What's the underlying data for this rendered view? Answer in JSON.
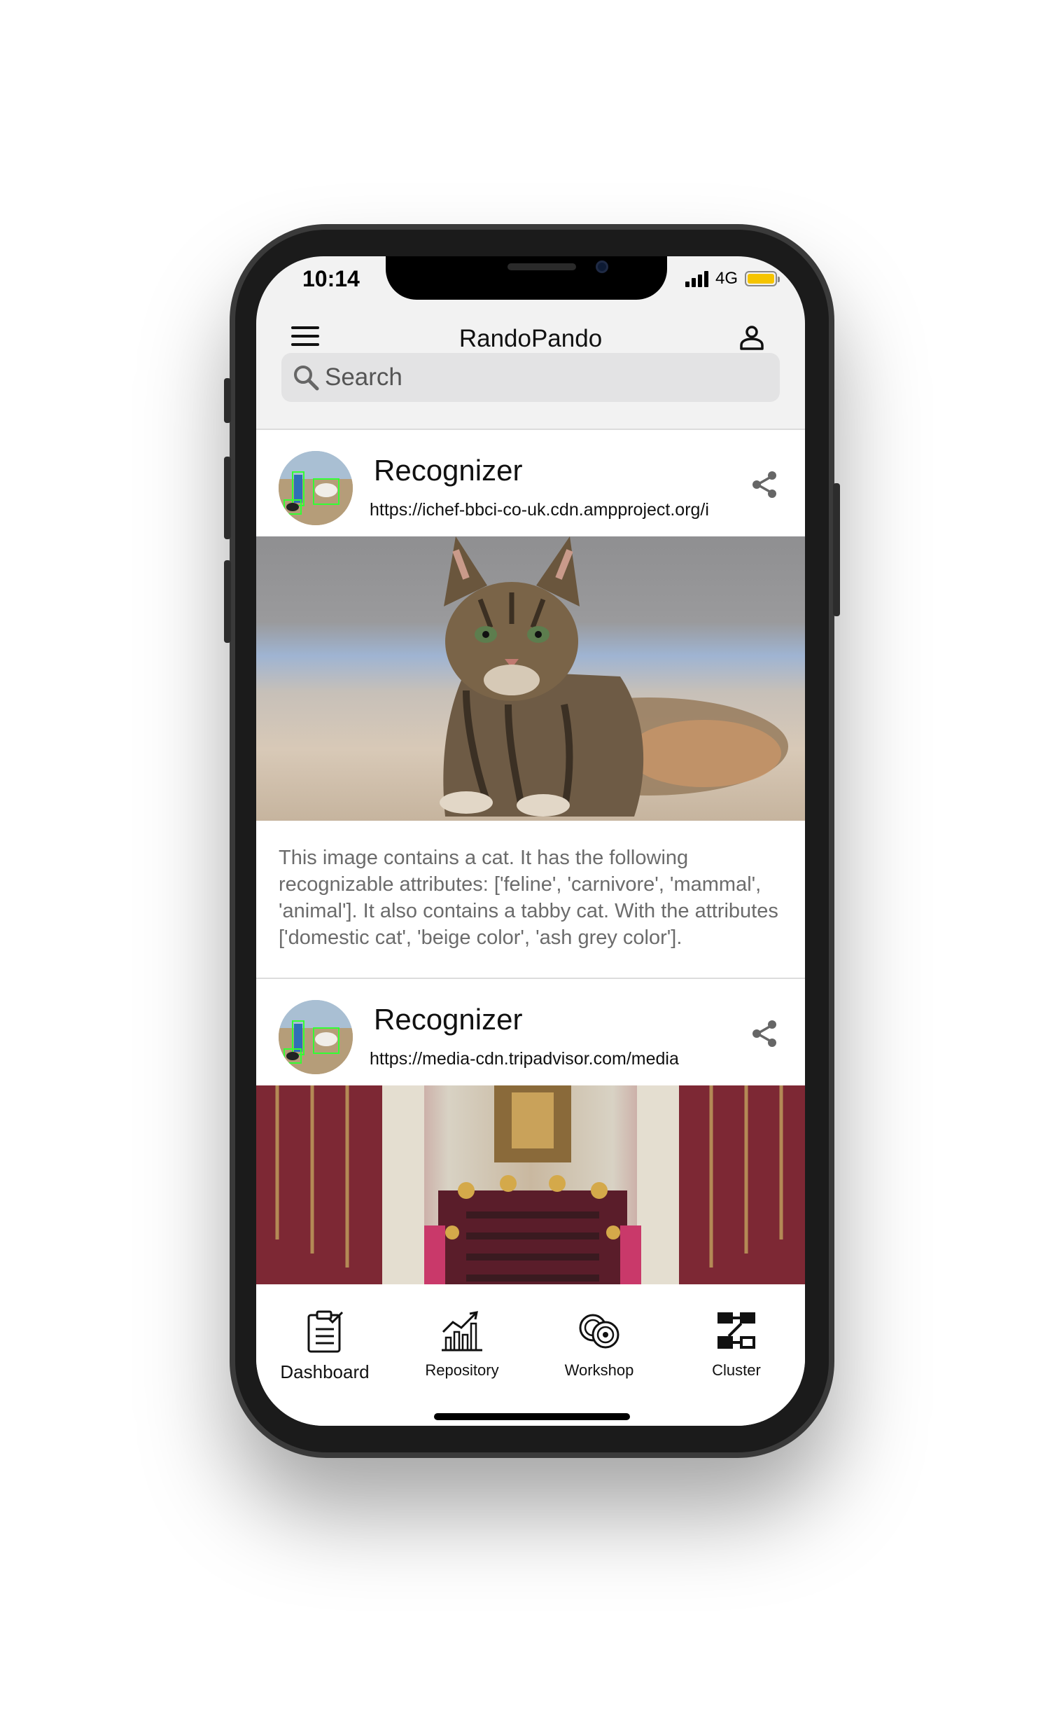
{
  "status_bar": {
    "time": "10:14",
    "network": "4G",
    "battery_color": "#f5c400"
  },
  "app_bar": {
    "title": "RandoPando",
    "menu_icon": "hamburger-menu-icon",
    "profile_icon": "user-profile-icon"
  },
  "search": {
    "placeholder": "Search",
    "value": ""
  },
  "feed": [
    {
      "title": "Recognizer",
      "url": "https://ichef-bbci-co-uk.cdn.ampproject.org/i",
      "image": "tabby-cat-photo",
      "description": "This image contains a cat. It has the following recognizable attributes: ['feline', 'carnivore', 'mammal', 'animal']. It also contains a tabby cat. With the attributes ['domestic cat', 'beige color', 'ash grey color']."
    },
    {
      "title": "Recognizer",
      "url": "https://media-cdn.tripadvisor.com/media",
      "image": "ornate-hall-interior-photo",
      "description": ""
    }
  ],
  "bottom_nav": [
    {
      "label": "Dashboard",
      "icon": "clipboard-checklist-icon",
      "active": true
    },
    {
      "label": "Repository",
      "icon": "growth-chart-icon",
      "active": false
    },
    {
      "label": "Workshop",
      "icon": "coins-icon",
      "active": false
    },
    {
      "label": "Cluster",
      "icon": "flow-nodes-icon",
      "active": false
    }
  ]
}
